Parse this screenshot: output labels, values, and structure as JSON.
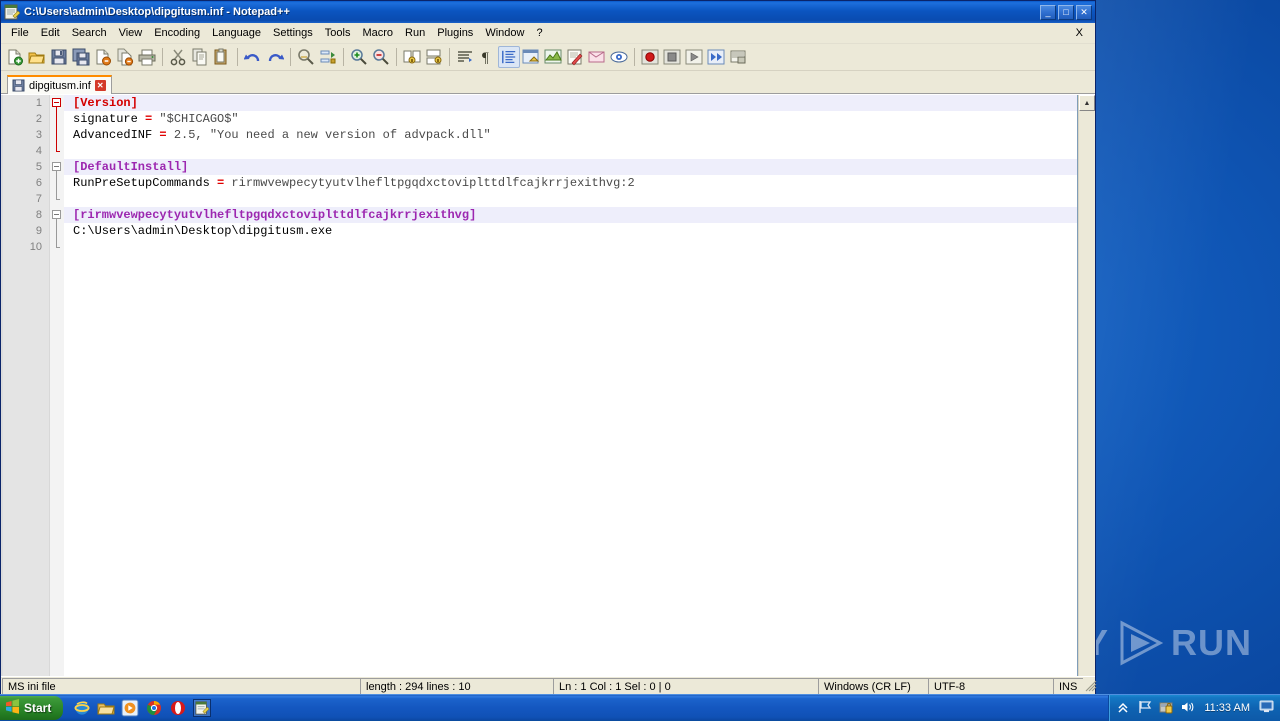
{
  "window": {
    "title": "C:\\Users\\admin\\Desktop\\dipgitusm.inf - Notepad++",
    "icon": "notepad-plus-plus-icon",
    "buttons": {
      "minimize": "_",
      "maximize": "□",
      "close": "✕"
    }
  },
  "menubar": {
    "items": [
      {
        "label": "File"
      },
      {
        "label": "Edit"
      },
      {
        "label": "Search"
      },
      {
        "label": "View"
      },
      {
        "label": "Encoding"
      },
      {
        "label": "Language"
      },
      {
        "label": "Settings"
      },
      {
        "label": "Tools"
      },
      {
        "label": "Macro"
      },
      {
        "label": "Run"
      },
      {
        "label": "Plugins"
      },
      {
        "label": "Window"
      },
      {
        "label": "?"
      }
    ],
    "close_document": "X"
  },
  "toolbar": {
    "items": [
      {
        "name": "new-file-icon"
      },
      {
        "name": "open-file-icon"
      },
      {
        "name": "save-icon"
      },
      {
        "name": "save-all-icon"
      },
      {
        "name": "close-file-icon"
      },
      {
        "name": "close-all-files-icon"
      },
      {
        "name": "print-icon"
      },
      {
        "name": "separator"
      },
      {
        "name": "cut-icon"
      },
      {
        "name": "copy-icon"
      },
      {
        "name": "paste-icon"
      },
      {
        "name": "separator"
      },
      {
        "name": "undo-icon"
      },
      {
        "name": "redo-icon"
      },
      {
        "name": "separator"
      },
      {
        "name": "find-icon"
      },
      {
        "name": "replace-icon"
      },
      {
        "name": "separator"
      },
      {
        "name": "zoom-in-icon"
      },
      {
        "name": "zoom-out-icon"
      },
      {
        "name": "separator"
      },
      {
        "name": "sync-vertical-scroll-icon"
      },
      {
        "name": "sync-horizontal-scroll-icon"
      },
      {
        "name": "separator"
      },
      {
        "name": "word-wrap-icon"
      },
      {
        "name": "show-all-characters-icon"
      },
      {
        "name": "indent-guide-icon"
      },
      {
        "name": "user-defined-dialog-icon"
      },
      {
        "name": "show-symbol-icon"
      },
      {
        "name": "document-map-icon"
      },
      {
        "name": "function-list-icon"
      },
      {
        "name": "folder-as-workspace-icon"
      },
      {
        "name": "monitoring-icon"
      },
      {
        "name": "separator"
      },
      {
        "name": "record-macro-icon"
      },
      {
        "name": "stop-recording-macro-icon"
      },
      {
        "name": "playback-macro-icon"
      },
      {
        "name": "run-macro-multiple-icon"
      },
      {
        "name": "save-macro-icon"
      }
    ]
  },
  "tabs": [
    {
      "label": "dipgitusm.inf",
      "icon": "saved-document-icon",
      "close": "✕",
      "active": true
    }
  ],
  "editor": {
    "lines": [
      {
        "number": "1",
        "alt": true,
        "fold": "open-red",
        "tokens": [
          {
            "t": "[Version]",
            "c": "tok-section-red"
          }
        ]
      },
      {
        "number": "2",
        "alt": false,
        "fold": "none",
        "tokens": [
          {
            "t": "signature ",
            "c": "tok-key"
          },
          {
            "t": "=",
            "c": "tok-eq"
          },
          {
            "t": " \"$CHICAGO$\"",
            "c": "tok-val"
          }
        ]
      },
      {
        "number": "3",
        "alt": false,
        "fold": "none",
        "tokens": [
          {
            "t": "AdvancedINF ",
            "c": "tok-key"
          },
          {
            "t": "=",
            "c": "tok-eq"
          },
          {
            "t": " 2.5, \"You need a new version of advpack.dll\"",
            "c": "tok-val"
          }
        ]
      },
      {
        "number": "4",
        "alt": false,
        "fold": "tail-red",
        "tokens": []
      },
      {
        "number": "5",
        "alt": true,
        "fold": "open",
        "tokens": [
          {
            "t": "[DefaultInstall]",
            "c": "tok-section"
          }
        ]
      },
      {
        "number": "6",
        "alt": false,
        "fold": "none",
        "tokens": [
          {
            "t": "RunPreSetupCommands ",
            "c": "tok-key"
          },
          {
            "t": "=",
            "c": "tok-eq"
          },
          {
            "t": " rirmwvewpecytyutvlhefltpgqdxctoviplttdlfcajkrrjexithvg:2",
            "c": "tok-val"
          }
        ]
      },
      {
        "number": "7",
        "alt": false,
        "fold": "tail",
        "tokens": []
      },
      {
        "number": "8",
        "alt": true,
        "fold": "open",
        "tokens": [
          {
            "t": "[rirmwvewpecytyutvlhefltpgqdxctoviplttdlfcajkrrjexithvg]",
            "c": "tok-section"
          }
        ]
      },
      {
        "number": "9",
        "alt": false,
        "fold": "none",
        "tokens": [
          {
            "t": "C:\\Users\\admin\\Desktop\\dipgitusm.exe",
            "c": "tok-plain"
          }
        ]
      },
      {
        "number": "10",
        "alt": false,
        "fold": "tail",
        "tokens": []
      }
    ]
  },
  "statusbar": {
    "language": "MS ini file",
    "length_lines": "length : 294    lines : 10",
    "caret": "Ln : 1    Col : 1    Sel : 0 | 0",
    "eol": "Windows (CR LF)",
    "encoding": "UTF-8",
    "insert_mode": "INS"
  },
  "taskbar": {
    "start_label": "Start",
    "quicklaunch": [
      {
        "name": "internet-explorer-icon"
      },
      {
        "name": "file-explorer-icon"
      },
      {
        "name": "media-player-icon"
      },
      {
        "name": "google-chrome-icon"
      },
      {
        "name": "opera-icon"
      },
      {
        "name": "notepad-plus-plus-taskbar-icon"
      }
    ],
    "tray": [
      {
        "name": "show-hidden-icons-icon"
      },
      {
        "name": "network-flag-icon"
      },
      {
        "name": "security-shield-icon"
      },
      {
        "name": "volume-icon"
      }
    ],
    "clock": "11:33 AM",
    "show-desktop": "show-desktop-icon"
  },
  "watermark": {
    "left": "ANY",
    "right": "RUN",
    "logo": "anyrun-play-logo"
  },
  "colors": {
    "title_blue": "#0a4bb0",
    "section_red": "#d40000",
    "section_purple": "#9c27b0",
    "operator_red": "#e00000",
    "value_grey": "#4a4a4a",
    "alt_line_bg": "#eeeefb",
    "chrome": "#ece9d8",
    "tab_accent": "#ff8c00",
    "desktop_blue": "#0f55b4"
  }
}
